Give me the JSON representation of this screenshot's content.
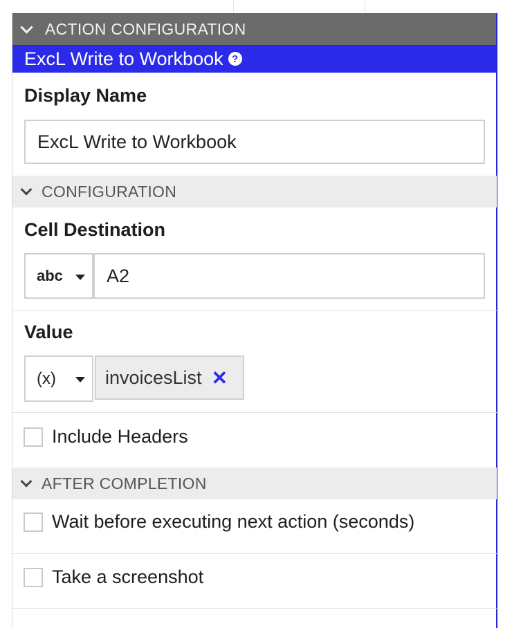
{
  "panel": {
    "header": "ACTION CONFIGURATION",
    "title": "ExcL Write to Workbook"
  },
  "display_name": {
    "label": "Display Name",
    "value": "ExcL Write to Workbook"
  },
  "configuration": {
    "header": "CONFIGURATION",
    "cell_destination": {
      "label": "Cell Destination",
      "type": "abc",
      "value": "A2"
    },
    "value_field": {
      "label": "Value",
      "type": "(x)",
      "variable": "invoicesList"
    },
    "include_headers": {
      "label": "Include Headers",
      "checked": false
    }
  },
  "after_completion": {
    "header": "AFTER COMPLETION",
    "wait": {
      "label": "Wait before executing next action (seconds)",
      "checked": false
    },
    "screenshot": {
      "label": "Take a screenshot",
      "checked": false
    }
  },
  "colors": {
    "accent": "#2a2ae8",
    "header_bg": "#6b6b6b",
    "section_bg": "#ececec"
  }
}
